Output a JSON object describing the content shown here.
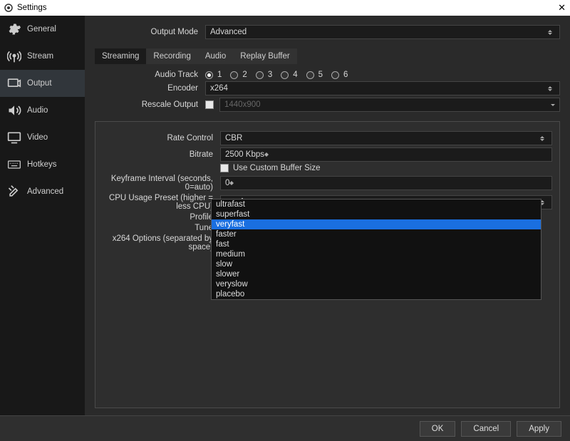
{
  "window": {
    "title": "Settings"
  },
  "sidebar": {
    "items": [
      {
        "label": "General"
      },
      {
        "label": "Stream"
      },
      {
        "label": "Output"
      },
      {
        "label": "Audio"
      },
      {
        "label": "Video"
      },
      {
        "label": "Hotkeys"
      },
      {
        "label": "Advanced"
      }
    ],
    "selected_index": 2
  },
  "output_mode": {
    "label": "Output Mode",
    "value": "Advanced"
  },
  "tabs": {
    "items": [
      "Streaming",
      "Recording",
      "Audio",
      "Replay Buffer"
    ],
    "active_index": 0
  },
  "audio_track": {
    "label": "Audio Track",
    "options": [
      "1",
      "2",
      "3",
      "4",
      "5",
      "6"
    ],
    "selected_index": 0
  },
  "encoder": {
    "label": "Encoder",
    "value": "x264"
  },
  "rescale": {
    "label": "Rescale Output",
    "checked": false,
    "value": "1440x900"
  },
  "rate_control": {
    "label": "Rate Control",
    "value": "CBR"
  },
  "bitrate": {
    "label": "Bitrate",
    "value": "2500 Kbps"
  },
  "custom_buffer": {
    "label": "Use Custom Buffer Size",
    "checked": false
  },
  "keyframe": {
    "label": "Keyframe Interval (seconds, 0=auto)",
    "value": "0"
  },
  "cpu_preset": {
    "label": "CPU Usage Preset (higher = less CPU)",
    "value": "veryfast",
    "options": [
      "ultrafast",
      "superfast",
      "veryfast",
      "faster",
      "fast",
      "medium",
      "slow",
      "slower",
      "veryslow",
      "placebo"
    ],
    "highlighted": "veryfast"
  },
  "profile": {
    "label": "Profile"
  },
  "tune": {
    "label": "Tune"
  },
  "x264_options": {
    "label": "x264 Options (separated by space)"
  },
  "footer": {
    "ok": "OK",
    "cancel": "Cancel",
    "apply": "Apply"
  }
}
